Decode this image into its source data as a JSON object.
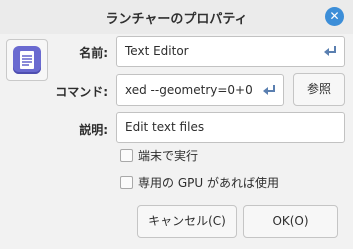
{
  "window": {
    "title": "ランチャーのプロパティ"
  },
  "icons": {
    "close": "close-icon",
    "app": "text-editor-icon",
    "enter": "enter-icon"
  },
  "form": {
    "name_label": "名前:",
    "name_value": "Text Editor",
    "command_label": "コマンド:",
    "command_value": "xed --geometry=0+0",
    "browse_label": "参照",
    "comment_label": "説明:",
    "comment_value": "Edit text files"
  },
  "options": {
    "terminal_label": "端末で実行",
    "terminal_checked": false,
    "gpu_label": "専用の GPU があれば使用",
    "gpu_checked": false
  },
  "buttons": {
    "cancel_label": "キャンセル(C)",
    "ok_label": "OK(O)"
  },
  "colors": {
    "accent": "#3c8ed8",
    "app_icon": "#6a6ad0"
  }
}
